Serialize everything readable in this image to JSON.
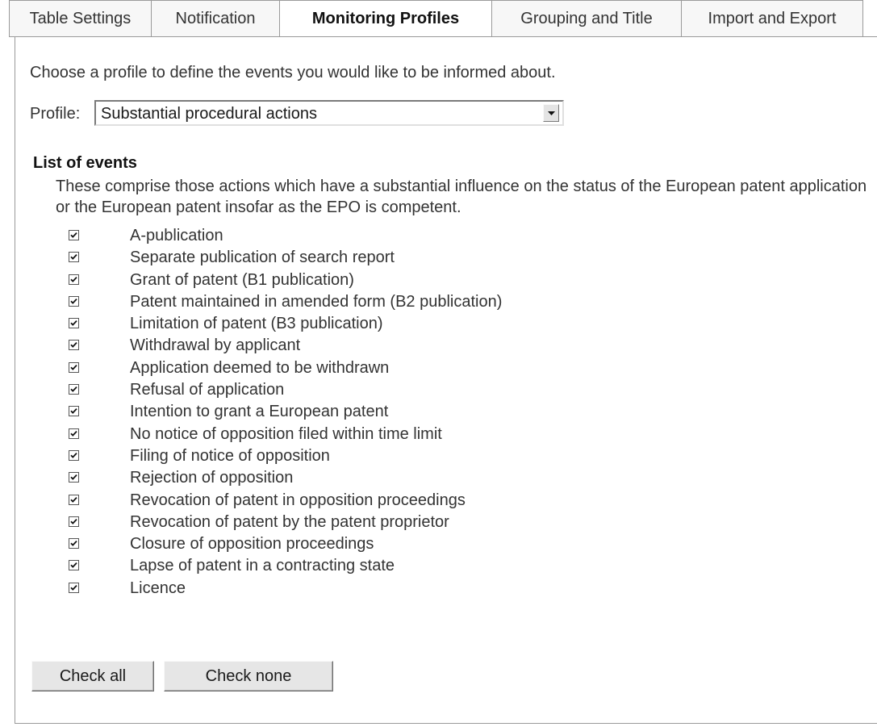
{
  "tabs": [
    {
      "label": "Table Settings",
      "active": false
    },
    {
      "label": "Notification",
      "active": false
    },
    {
      "label": "Monitoring Profiles",
      "active": true
    },
    {
      "label": "Grouping and Title",
      "active": false
    },
    {
      "label": "Import and Export",
      "active": false
    }
  ],
  "intro_text": "Choose a profile to define the events you would like to be informed about.",
  "profile": {
    "label": "Profile:",
    "selected": "Substantial procedural actions"
  },
  "events_section": {
    "heading": "List of events",
    "description": "These comprise those actions which have a substantial influence on the status of the European patent application or the European patent insofar as the EPO is competent.",
    "items": [
      {
        "label": "A-publication",
        "checked": true
      },
      {
        "label": "Separate publication of search report",
        "checked": true
      },
      {
        "label": "Grant of patent (B1 publication)",
        "checked": true
      },
      {
        "label": "Patent maintained in amended form (B2 publication)",
        "checked": true
      },
      {
        "label": "Limitation of patent (B3 publication)",
        "checked": true
      },
      {
        "label": "Withdrawal by applicant",
        "checked": true
      },
      {
        "label": "Application deemed to be withdrawn",
        "checked": true
      },
      {
        "label": "Refusal of application",
        "checked": true
      },
      {
        "label": "Intention to grant a European patent",
        "checked": true
      },
      {
        "label": "No notice of opposition filed within time limit",
        "checked": true
      },
      {
        "label": "Filing of notice of opposition",
        "checked": true
      },
      {
        "label": "Rejection of opposition",
        "checked": true
      },
      {
        "label": "Revocation of patent in opposition proceedings",
        "checked": true
      },
      {
        "label": "Revocation of patent by the patent proprietor",
        "checked": true
      },
      {
        "label": "Closure of opposition proceedings",
        "checked": true
      },
      {
        "label": "Lapse of patent in a contracting state",
        "checked": true
      },
      {
        "label": "Licence",
        "checked": true
      }
    ]
  },
  "buttons": {
    "check_all": "Check all",
    "check_none": "Check none"
  }
}
